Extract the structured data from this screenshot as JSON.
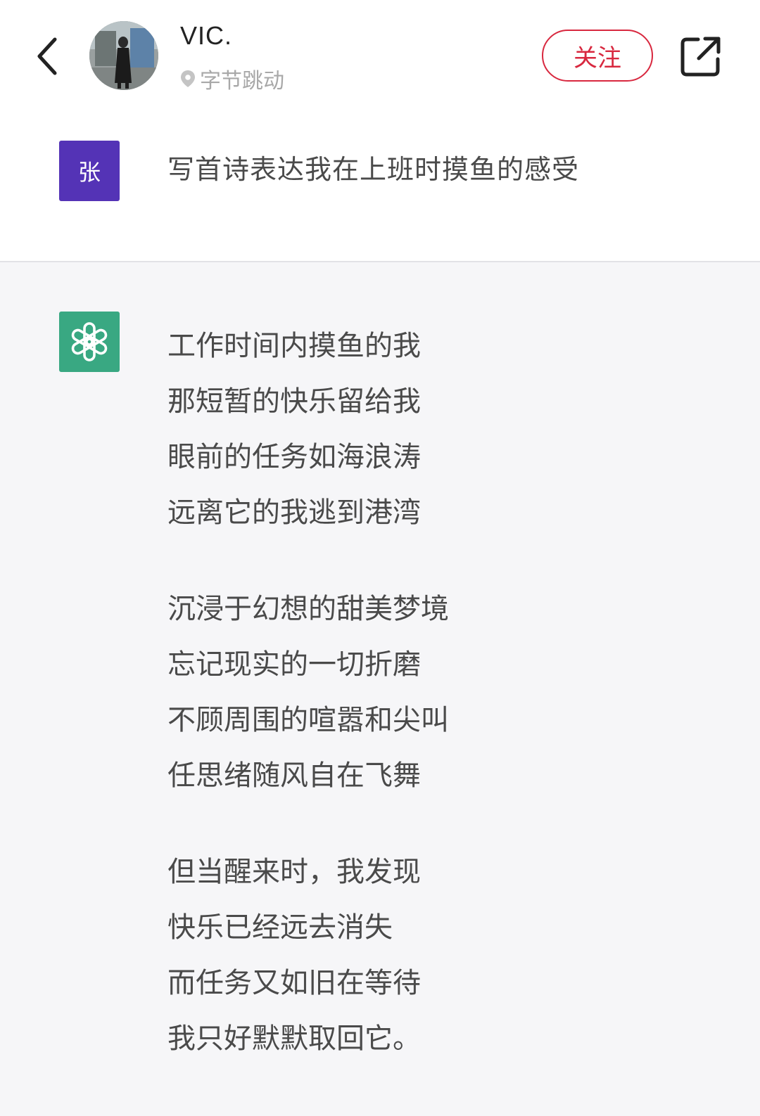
{
  "header": {
    "author_name": "VIC.",
    "location": "字节跳动",
    "follow_label": "关注",
    "back_icon": "chevron-left-icon",
    "share_icon": "external-share-icon",
    "location_icon": "location-pin-icon"
  },
  "conversation": {
    "user": {
      "avatar_text": "张",
      "avatar_color": "#5433b6",
      "message": "写首诗表达我在上班时摸鱼的感受"
    },
    "assistant": {
      "avatar_icon": "openai-logo-icon",
      "avatar_color": "#39a882",
      "stanzas": [
        {
          "lines": [
            "工作时间内摸鱼的我",
            "那短暂的快乐留给我",
            "眼前的任务如海浪涛",
            "远离它的我逃到港湾"
          ]
        },
        {
          "lines": [
            "沉浸于幻想的甜美梦境",
            "忘记现实的一切折磨",
            "不顾周围的喧嚣和尖叫",
            "任思绪随风自在飞舞"
          ]
        },
        {
          "lines": [
            "但当醒来时，我发现",
            "快乐已经远去消失",
            "而任务又如旧在等待",
            "我只好默默取回它。"
          ]
        }
      ]
    }
  },
  "colors": {
    "accent": "#d8283f",
    "assistant_bg": "#f6f6f8"
  }
}
